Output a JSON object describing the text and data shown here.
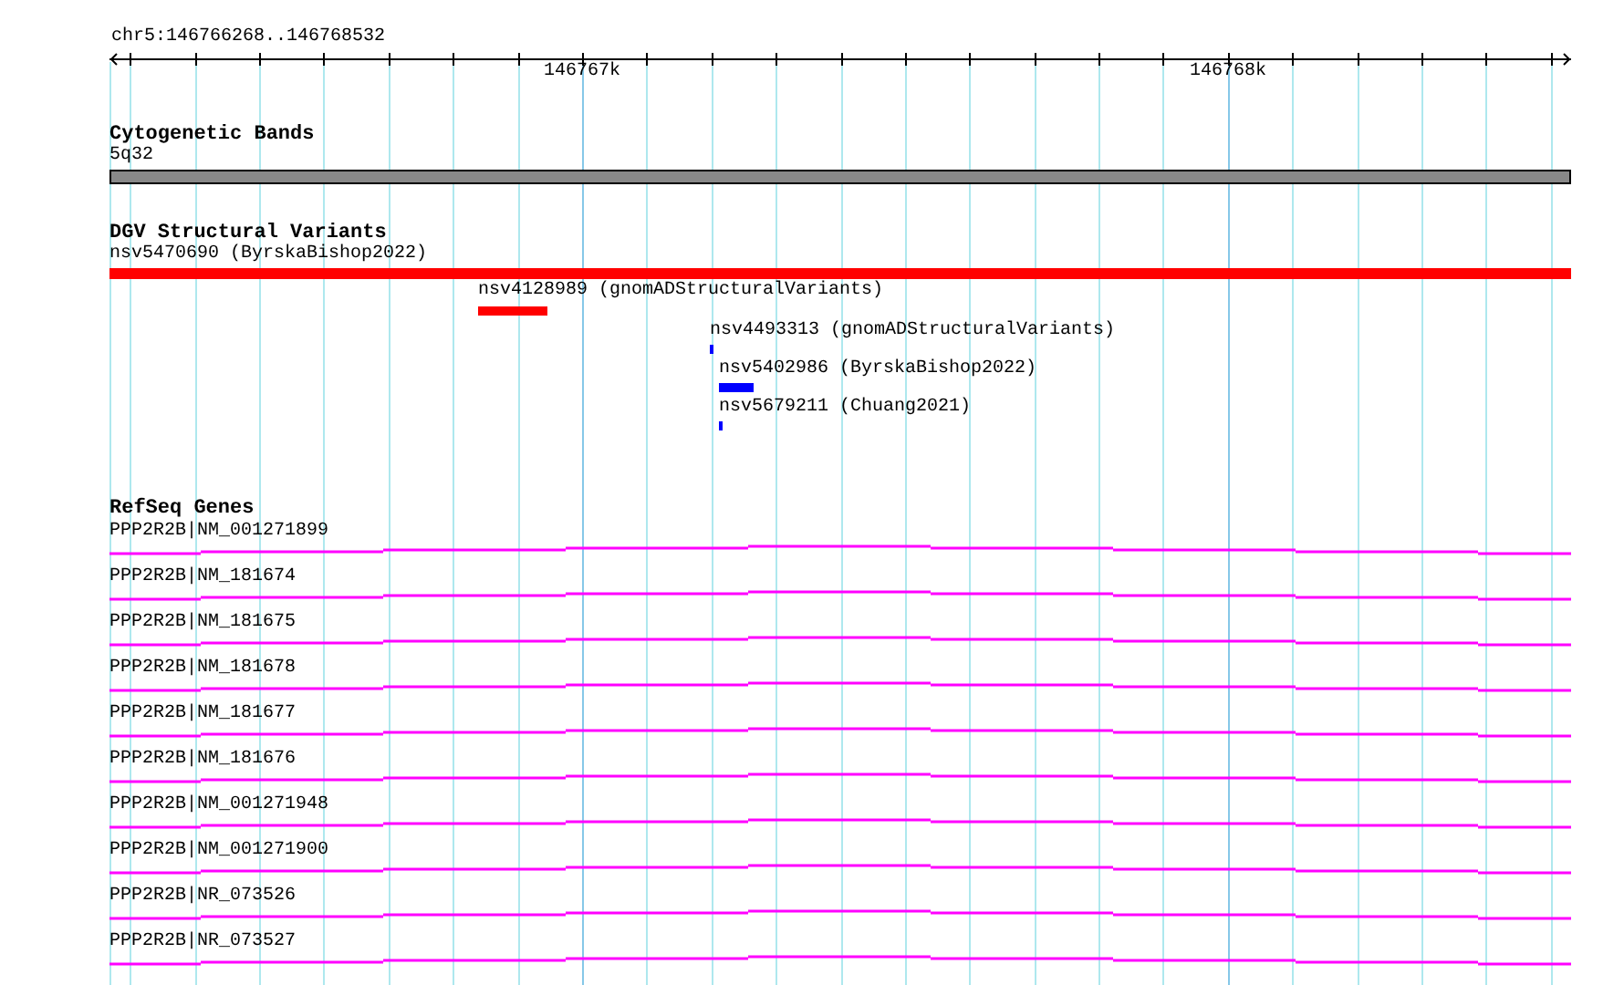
{
  "ruler": {
    "region": "chr5:146766268..146768532",
    "major_ticks": [
      "146767k",
      "146768k"
    ]
  },
  "tracks": [
    {
      "kind": "band",
      "title": "Cytogenetic Bands",
      "features": [
        {
          "label": "5q32"
        }
      ]
    },
    {
      "kind": "variant",
      "title": "DGV Structural Variants",
      "features": [
        {
          "label": "nsv5470690 (ByrskaBishop2022)",
          "color": "#ff0000"
        },
        {
          "label": "nsv4128989 (gnomADStructuralVariants)",
          "color": "#ff0000"
        },
        {
          "label": "nsv4493313 (gnomADStructuralVariants)",
          "color": "#0000ff"
        },
        {
          "label": "nsv5402986 (ByrskaBishop2022)",
          "color": "#0000ff"
        },
        {
          "label": "nsv5679211 (Chuang2021)",
          "color": "#0000ff"
        }
      ]
    },
    {
      "kind": "gene",
      "title": "RefSeq Genes",
      "features": [
        {
          "label": "PPP2R2B|NM_001271899"
        },
        {
          "label": "PPP2R2B|NM_181674"
        },
        {
          "label": "PPP2R2B|NM_181675"
        },
        {
          "label": "PPP2R2B|NM_181678"
        },
        {
          "label": "PPP2R2B|NM_181677"
        },
        {
          "label": "PPP2R2B|NM_181676"
        },
        {
          "label": "PPP2R2B|NM_001271948"
        },
        {
          "label": "PPP2R2B|NM_001271900"
        },
        {
          "label": "PPP2R2B|NR_073526"
        },
        {
          "label": "PPP2R2B|NR_073527"
        }
      ]
    }
  ]
}
